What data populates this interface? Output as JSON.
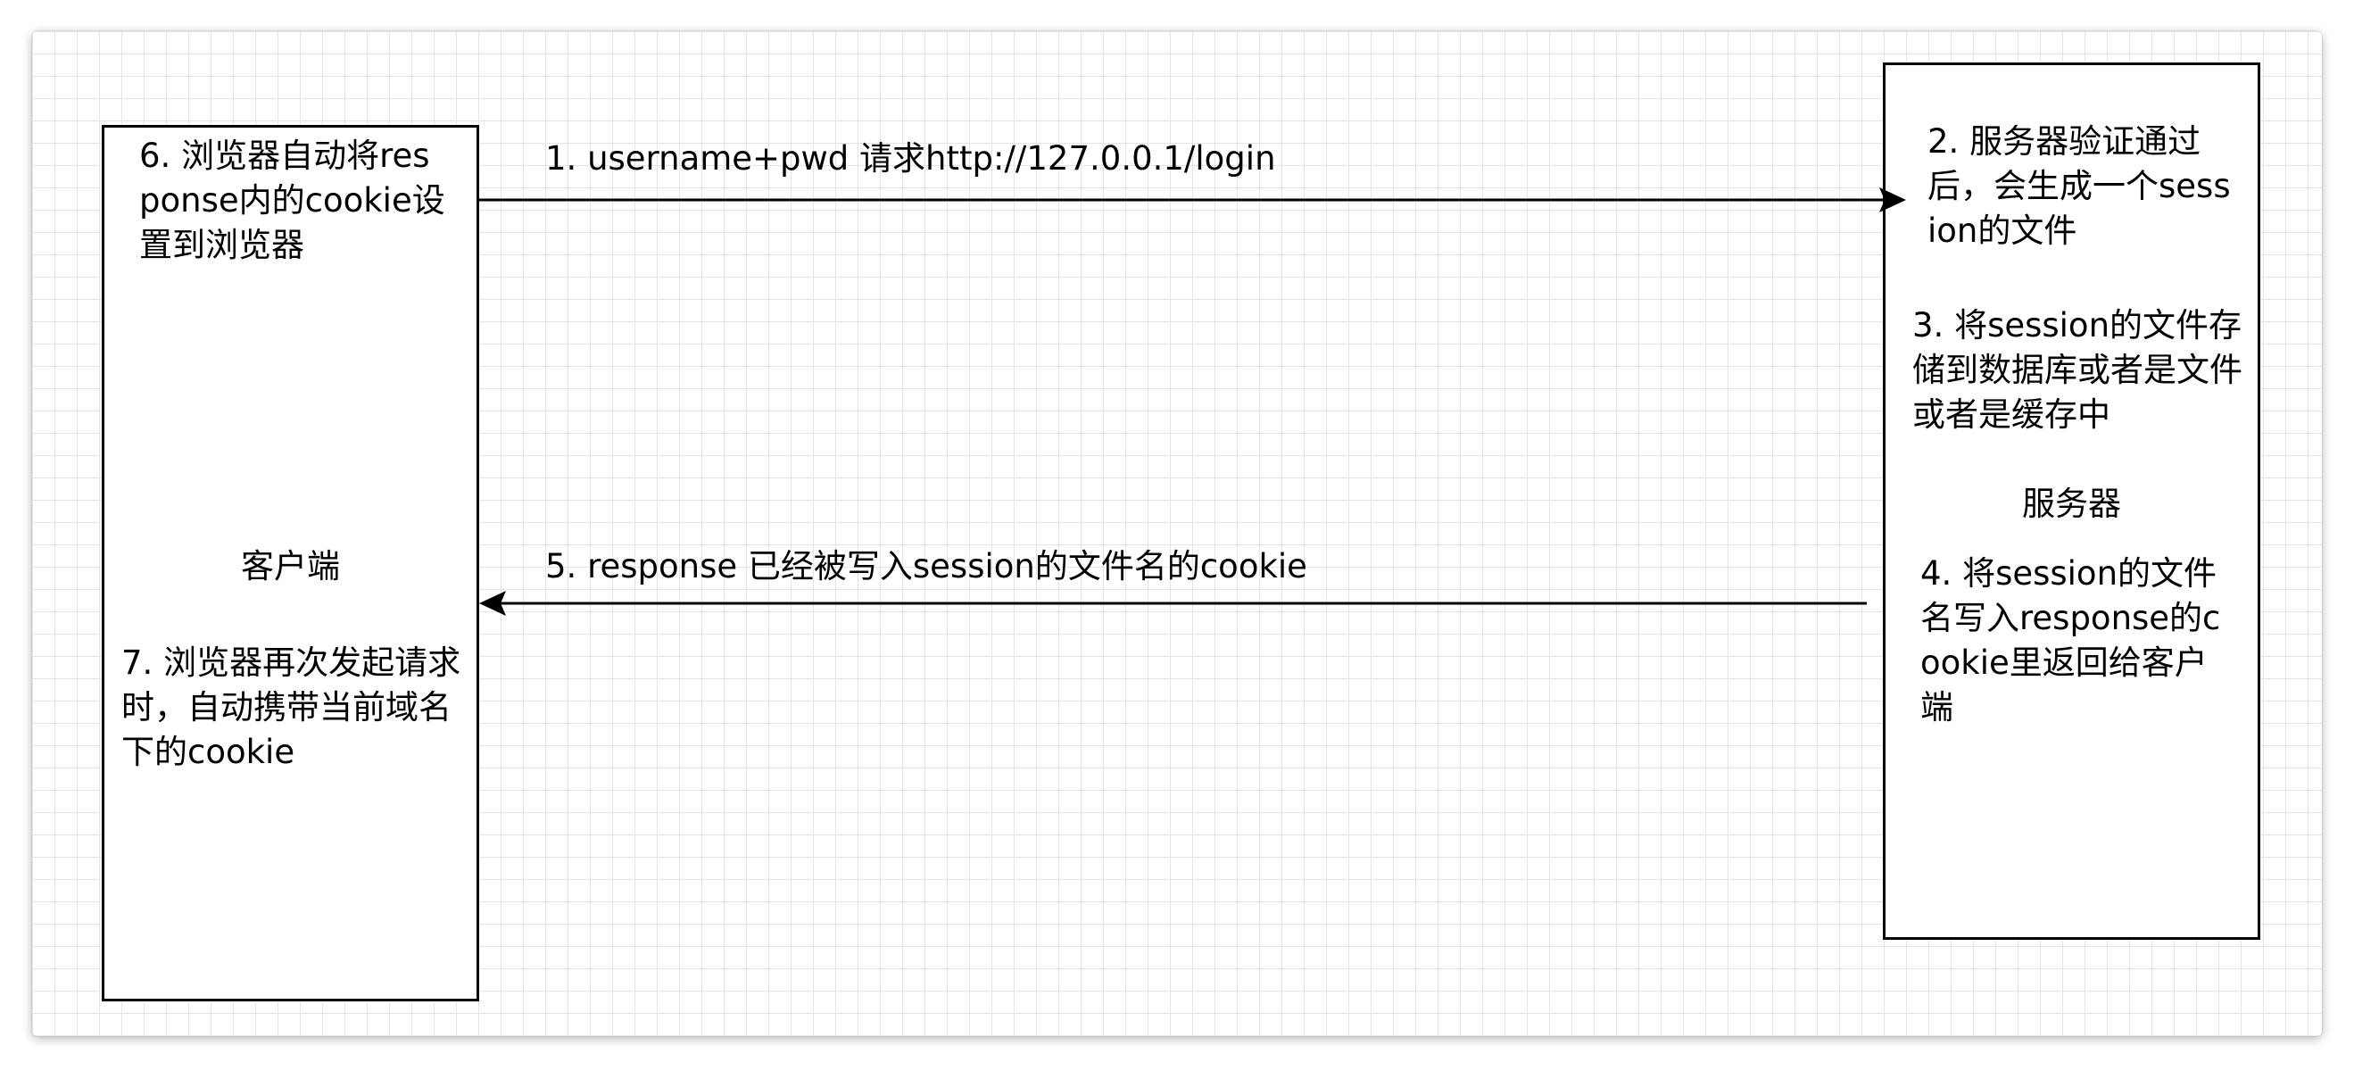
{
  "client": {
    "name": "客户端",
    "step6": "6. 浏览器自动将response内的cookie设置到浏览器",
    "step7": "7. 浏览器再次发起请求时，自动携带当前域名下的cookie"
  },
  "server": {
    "name": "服务器",
    "step2": "2. 服务器验证通过后，会生成一个session的文件",
    "step3": "3. 将session的文件存储到数据库或者是文件或者是缓存中",
    "step4": "4. 将session的文件名写入response的cookie里返回给客户端"
  },
  "edges": {
    "request": "1.  username+pwd  请求http://127.0.0.1/login",
    "response": "5.  response 已经被写入session的文件名的cookie"
  },
  "colors": {
    "stroke": "#000000",
    "grid": "#e4e4e4",
    "background": "#ffffff"
  }
}
